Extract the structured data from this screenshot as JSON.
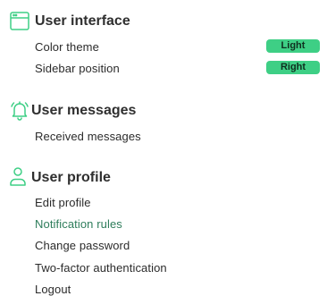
{
  "sections": {
    "ui": {
      "title": "User interface",
      "icon": "browser-window-icon",
      "items": [
        {
          "label": "Color theme",
          "value": "Light"
        },
        {
          "label": "Sidebar position",
          "value": "Right"
        }
      ]
    },
    "messages": {
      "title": "User messages",
      "icon": "bell-icon",
      "items": [
        {
          "label": "Received messages"
        }
      ]
    },
    "profile": {
      "title": "User profile",
      "icon": "user-icon",
      "items": [
        {
          "label": "Edit profile"
        },
        {
          "label": "Notification rules"
        },
        {
          "label": "Change password"
        },
        {
          "label": "Two-factor authentication"
        },
        {
          "label": "Logout"
        }
      ]
    }
  },
  "colors": {
    "accent": "#3ecf85",
    "icon": "#3ecf85",
    "active_link": "#2e7d5b"
  }
}
